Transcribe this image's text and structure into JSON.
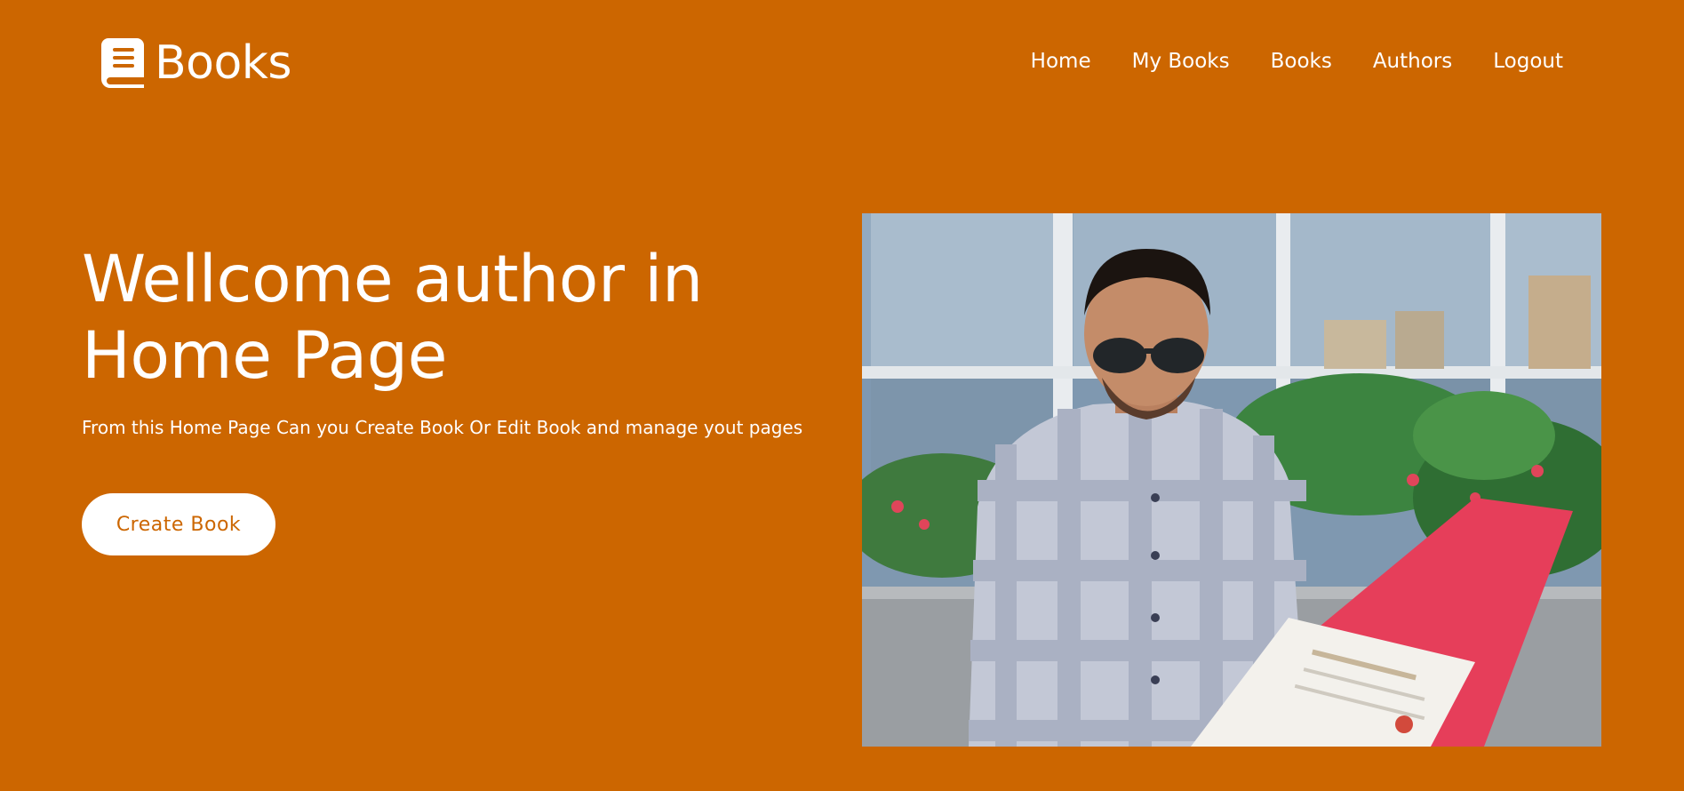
{
  "brand": {
    "name": "Books",
    "icon": "book-icon"
  },
  "nav": [
    {
      "label": "Home"
    },
    {
      "label": "My Books"
    },
    {
      "label": "Books"
    },
    {
      "label": "Authors"
    },
    {
      "label": "Logout"
    }
  ],
  "hero": {
    "title": "Wellcome author in Home Page",
    "subtitle": "From this Home Page Can you Create Book Or Edit Book and manage yout pages",
    "cta_label": "Create Book"
  },
  "colors": {
    "background": "#cc6600",
    "button_bg": "#ffffff",
    "button_text": "#cc6600",
    "text": "#ffffff"
  }
}
